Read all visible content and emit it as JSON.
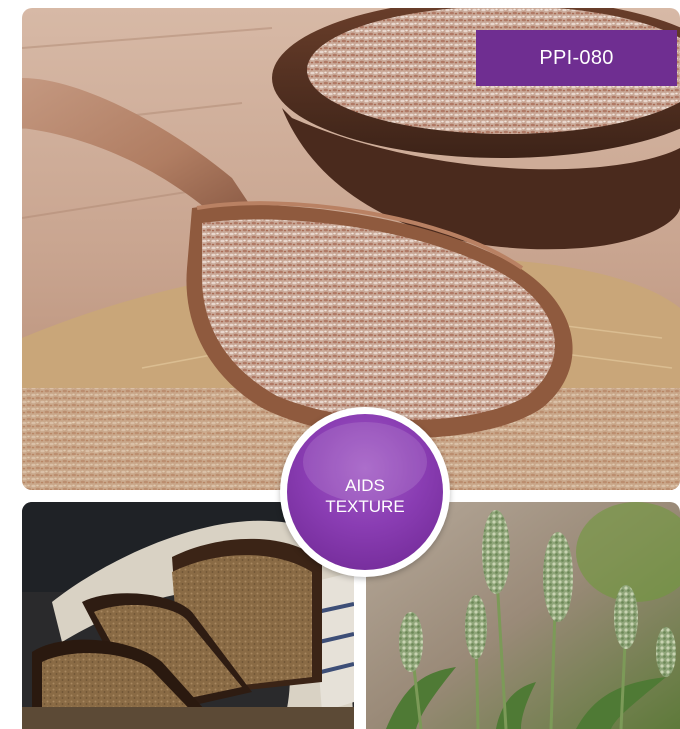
{
  "product_tag": "PPI-080",
  "badge": {
    "line1": "AIDS",
    "line2": "TEXTURE"
  },
  "images": {
    "hero": "psyllium-husk-wooden-spoon-photo",
    "bottom_left": "sliced-dark-bread-photo",
    "bottom_right": "plantago-plant-spikes-photo"
  },
  "colors": {
    "brand_purple": "#6f2e91",
    "badge_purple": "#8a3db3"
  }
}
